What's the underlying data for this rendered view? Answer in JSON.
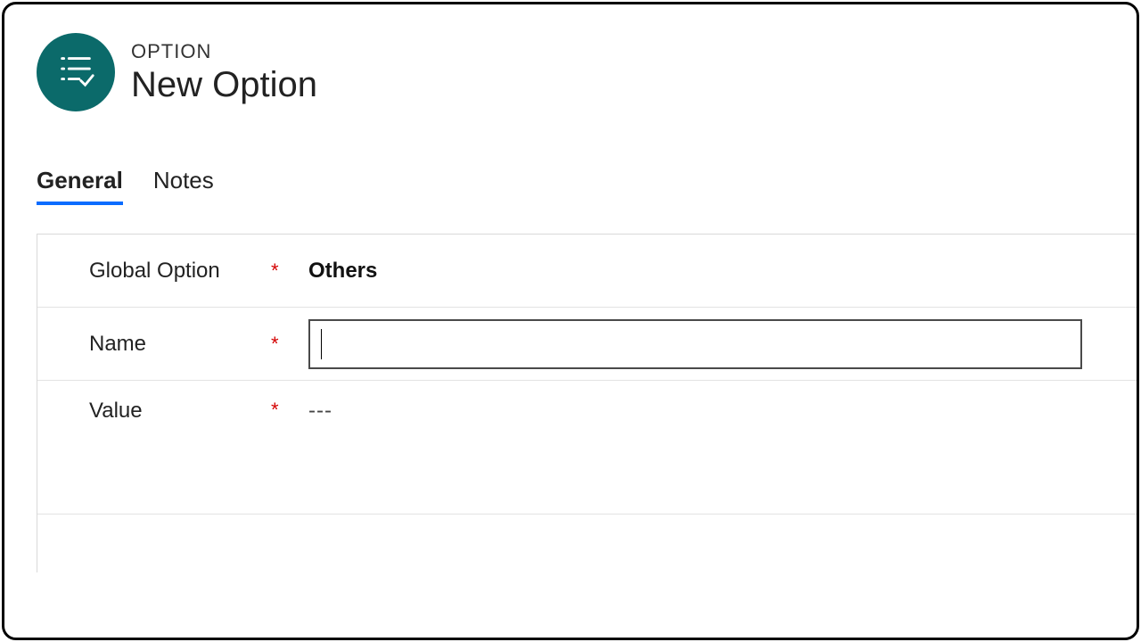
{
  "header": {
    "kicker": "OPTION",
    "title": "New Option"
  },
  "tabs": [
    {
      "label": "General",
      "active": true
    },
    {
      "label": "Notes",
      "active": false
    }
  ],
  "form": {
    "global_option": {
      "label": "Global Option",
      "required": "*",
      "value": "Others"
    },
    "name": {
      "label": "Name",
      "required": "*",
      "value": ""
    },
    "value_field": {
      "label": "Value",
      "required": "*",
      "value": "---"
    }
  }
}
